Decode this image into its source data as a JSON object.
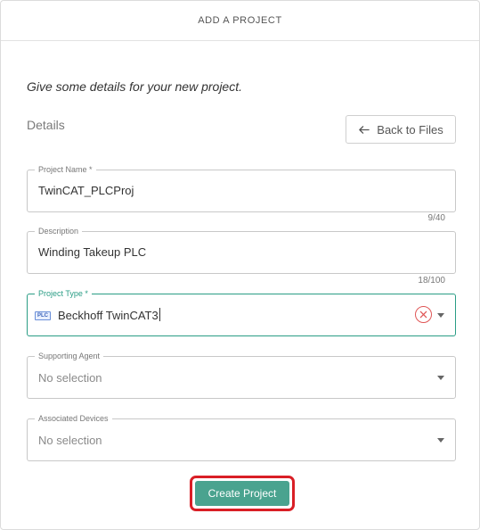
{
  "header": {
    "title": "ADD A PROJECT"
  },
  "intro": "Give some details for your new project.",
  "section": {
    "title": "Details",
    "back_label": "Back to Files"
  },
  "fields": {
    "project_name": {
      "label": "Project Name *",
      "value": "TwinCAT_PLCProj",
      "counter": "9/40"
    },
    "description": {
      "label": "Description",
      "value": "Winding Takeup PLC",
      "counter": "18/100"
    },
    "project_type": {
      "label": "Project Type *",
      "value": "Beckhoff TwinCAT3",
      "badge": "PLC",
      "icon": "plc-icon"
    },
    "supporting_agent": {
      "label": "Supporting Agent",
      "placeholder": "No selection"
    },
    "associated_devices": {
      "label": "Associated Devices",
      "placeholder": "No selection"
    }
  },
  "actions": {
    "create_label": "Create Project"
  },
  "colors": {
    "accent": "#4aa38f",
    "focus": "#2a9d85",
    "highlight": "#d91f26",
    "clear": "#e05656"
  }
}
